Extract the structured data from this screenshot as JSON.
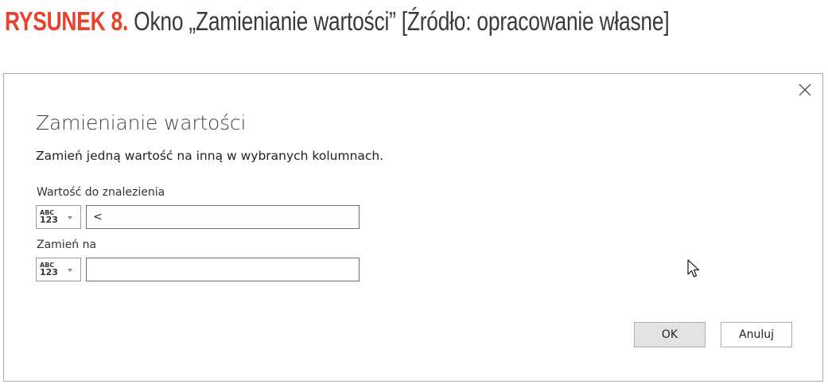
{
  "caption": {
    "label": "RYSUNEK 8.",
    "text": " Okno „Zamienianie wartości” [Źródło: opracowanie własne]"
  },
  "dialog": {
    "title": "Zamienianie wartości",
    "description": "Zamień jedną wartość na inną w wybranych kolumnach.",
    "find": {
      "label": "Wartość do znalezienia",
      "type_abc": "ABC",
      "type_num": "123",
      "value": "<"
    },
    "replace": {
      "label": "Zamień na",
      "type_abc": "ABC",
      "type_num": "123",
      "value": ""
    },
    "ok_label": "OK",
    "cancel_label": "Anuluj"
  },
  "icons": {
    "close": "close-icon",
    "type": "any-type-icon",
    "chevron": "chevron-down-icon",
    "cursor": "mouse-pointer-icon"
  },
  "colors": {
    "caption_accent": "#e8412c",
    "caption_text": "#3a3a3a",
    "dialog_border": "#aaaaaa",
    "ok_button_bg": "#e3e3e3"
  }
}
